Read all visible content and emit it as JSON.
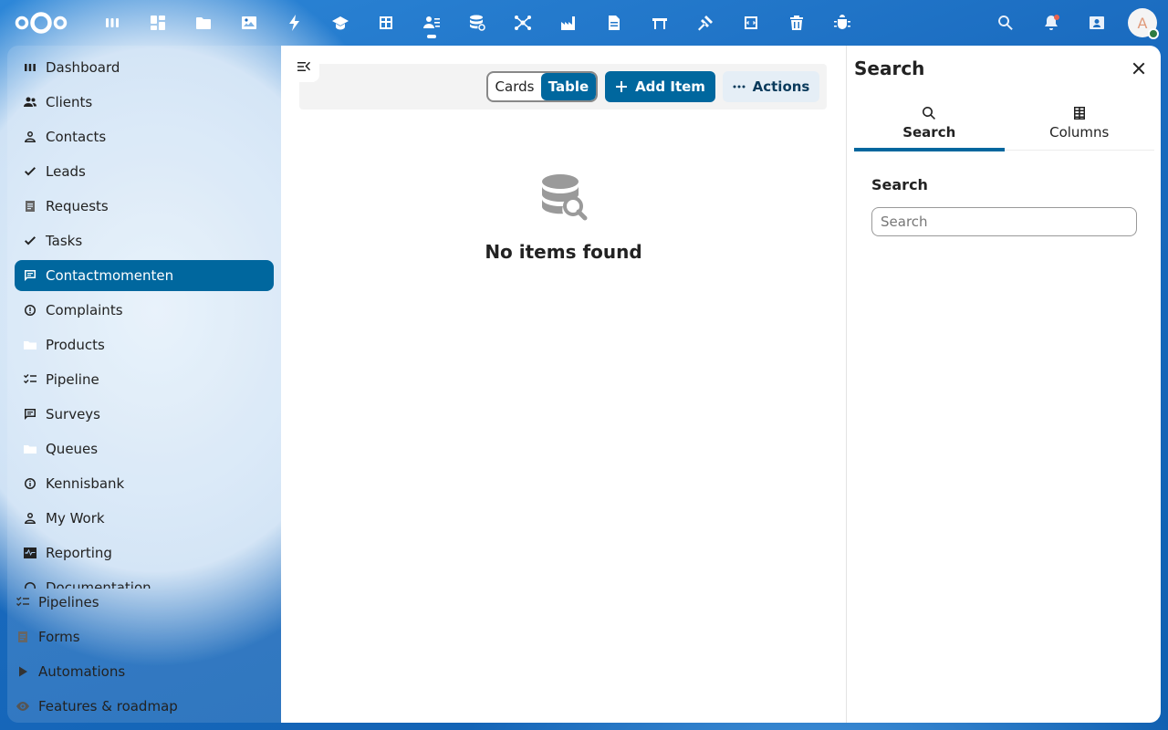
{
  "header": {
    "apps": [
      {
        "name": "dashboard-app-icon",
        "active": false
      },
      {
        "name": "widgets-app-icon",
        "active": false
      },
      {
        "name": "files-app-icon",
        "active": false
      },
      {
        "name": "photos-app-icon",
        "active": false
      },
      {
        "name": "activity-app-icon",
        "active": false
      },
      {
        "name": "learning-app-icon",
        "active": false
      },
      {
        "name": "tables-app-icon",
        "active": false
      },
      {
        "name": "crm-app-icon",
        "active": true
      },
      {
        "name": "database-app-icon",
        "active": false
      },
      {
        "name": "network-app-icon",
        "active": false
      },
      {
        "name": "factory-app-icon",
        "active": false
      },
      {
        "name": "document-app-icon",
        "active": false
      },
      {
        "name": "gate-app-icon",
        "active": false
      },
      {
        "name": "gavel-app-icon",
        "active": false
      },
      {
        "name": "code-app-icon",
        "active": false
      },
      {
        "name": "trash-app-icon",
        "active": false
      },
      {
        "name": "bug-app-icon",
        "active": false
      }
    ],
    "avatar_initial": "A"
  },
  "sidebar": {
    "items": [
      {
        "label": "Dashboard",
        "icon": "dashboard-icon",
        "active": false
      },
      {
        "label": "Clients",
        "icon": "group-icon",
        "active": false
      },
      {
        "label": "Contacts",
        "icon": "person-icon",
        "active": false
      },
      {
        "label": "Leads",
        "icon": "check-icon",
        "active": false
      },
      {
        "label": "Requests",
        "icon": "document-icon",
        "active": false
      },
      {
        "label": "Tasks",
        "icon": "check-icon",
        "active": false
      },
      {
        "label": "Contactmomenten",
        "icon": "message-icon",
        "active": true
      },
      {
        "label": "Complaints",
        "icon": "alert-circle-icon",
        "active": false
      },
      {
        "label": "Products",
        "icon": "folder-icon",
        "active": false
      },
      {
        "label": "Pipeline",
        "icon": "checklist-icon",
        "active": false
      },
      {
        "label": "Surveys",
        "icon": "message-icon",
        "active": false
      },
      {
        "label": "Queues",
        "icon": "folder-icon",
        "active": false
      },
      {
        "label": "Kennisbank",
        "icon": "info-icon",
        "active": false
      },
      {
        "label": "My Work",
        "icon": "person-icon",
        "active": false
      },
      {
        "label": "Reporting",
        "icon": "pulse-icon",
        "active": false
      },
      {
        "label": "Documentation",
        "icon": "help-icon",
        "active": false
      }
    ],
    "bottom_items": [
      {
        "label": "Pipelines",
        "icon": "checklist-icon"
      },
      {
        "label": "Forms",
        "icon": "document-icon"
      },
      {
        "label": "Automations",
        "icon": "play-icon"
      },
      {
        "label": "Features & roadmap",
        "icon": "eye-icon"
      }
    ]
  },
  "main": {
    "view_toggle": {
      "cards_label": "Cards",
      "table_label": "Table",
      "selected": "Table"
    },
    "add_label": "Add Item",
    "actions_label": "Actions",
    "empty_text": "No items found"
  },
  "right_sidebar": {
    "title": "Search",
    "tabs": [
      {
        "label": "Search",
        "active": true
      },
      {
        "label": "Columns",
        "active": false
      }
    ],
    "search_label": "Search",
    "search_placeholder": "Search",
    "search_value": ""
  }
}
